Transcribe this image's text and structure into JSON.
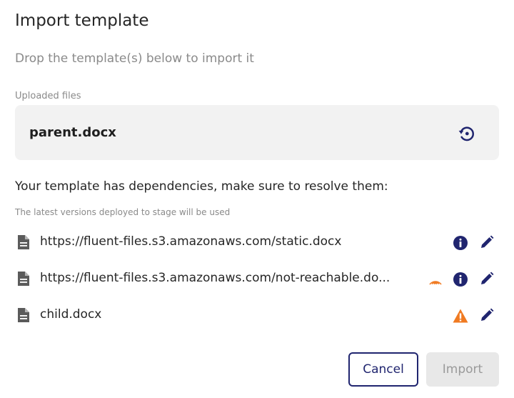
{
  "dialog": {
    "title": "Import template",
    "subtitle": "Drop the template(s) below to import it"
  },
  "uploaded": {
    "label": "Uploaded files",
    "file_name": "parent.docx"
  },
  "dependencies": {
    "message": "Your template has dependencies, make sure to resolve them:",
    "note": "The latest versions deployed to stage will be used",
    "items": [
      {
        "name": "https://fluent-files.s3.amazonaws.com/static.docx",
        "status": "info-icon"
      },
      {
        "name": "https://fluent-files.s3.amazonaws.com/not-reachable.do...",
        "status": "info-icon",
        "loading": true
      },
      {
        "name": "child.docx",
        "status": "warning-icon"
      }
    ]
  },
  "buttons": {
    "cancel": "Cancel",
    "import": "Import"
  },
  "colors": {
    "primary": "#20256f",
    "warning": "#f07a21",
    "surface": "#f2f2f2",
    "muted_text": "#8a8a8a",
    "disabled_bg": "#e8e8e8"
  }
}
